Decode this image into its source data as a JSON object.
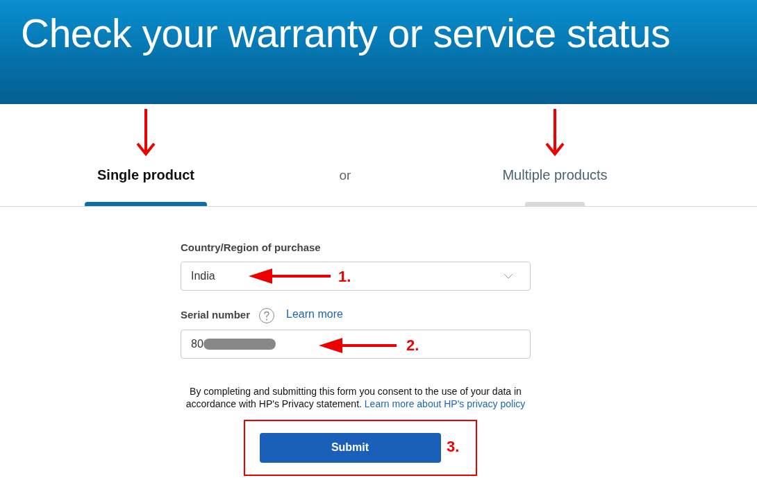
{
  "header": {
    "title": "Check your warranty or service status"
  },
  "tabs": [
    {
      "label": "Single product",
      "selected": true,
      "marked": true
    },
    {
      "label": "Multiple products",
      "selected": false,
      "marked": true
    }
  ],
  "tab_separator": "or",
  "form": {
    "country": {
      "label": "Country/Region of purchase",
      "value": "India",
      "step": "1."
    },
    "serial": {
      "label": "Serial number",
      "link": "Learn more",
      "value": "80",
      "redacted": true,
      "step": "2."
    },
    "consent": {
      "text": "By completing and submitting this form you consent to the use of your data in accordance with HP's Privacy statement.",
      "link": "Learn more about HP's privacy policy"
    },
    "submit": {
      "label": "Submit",
      "step": "3."
    }
  }
}
